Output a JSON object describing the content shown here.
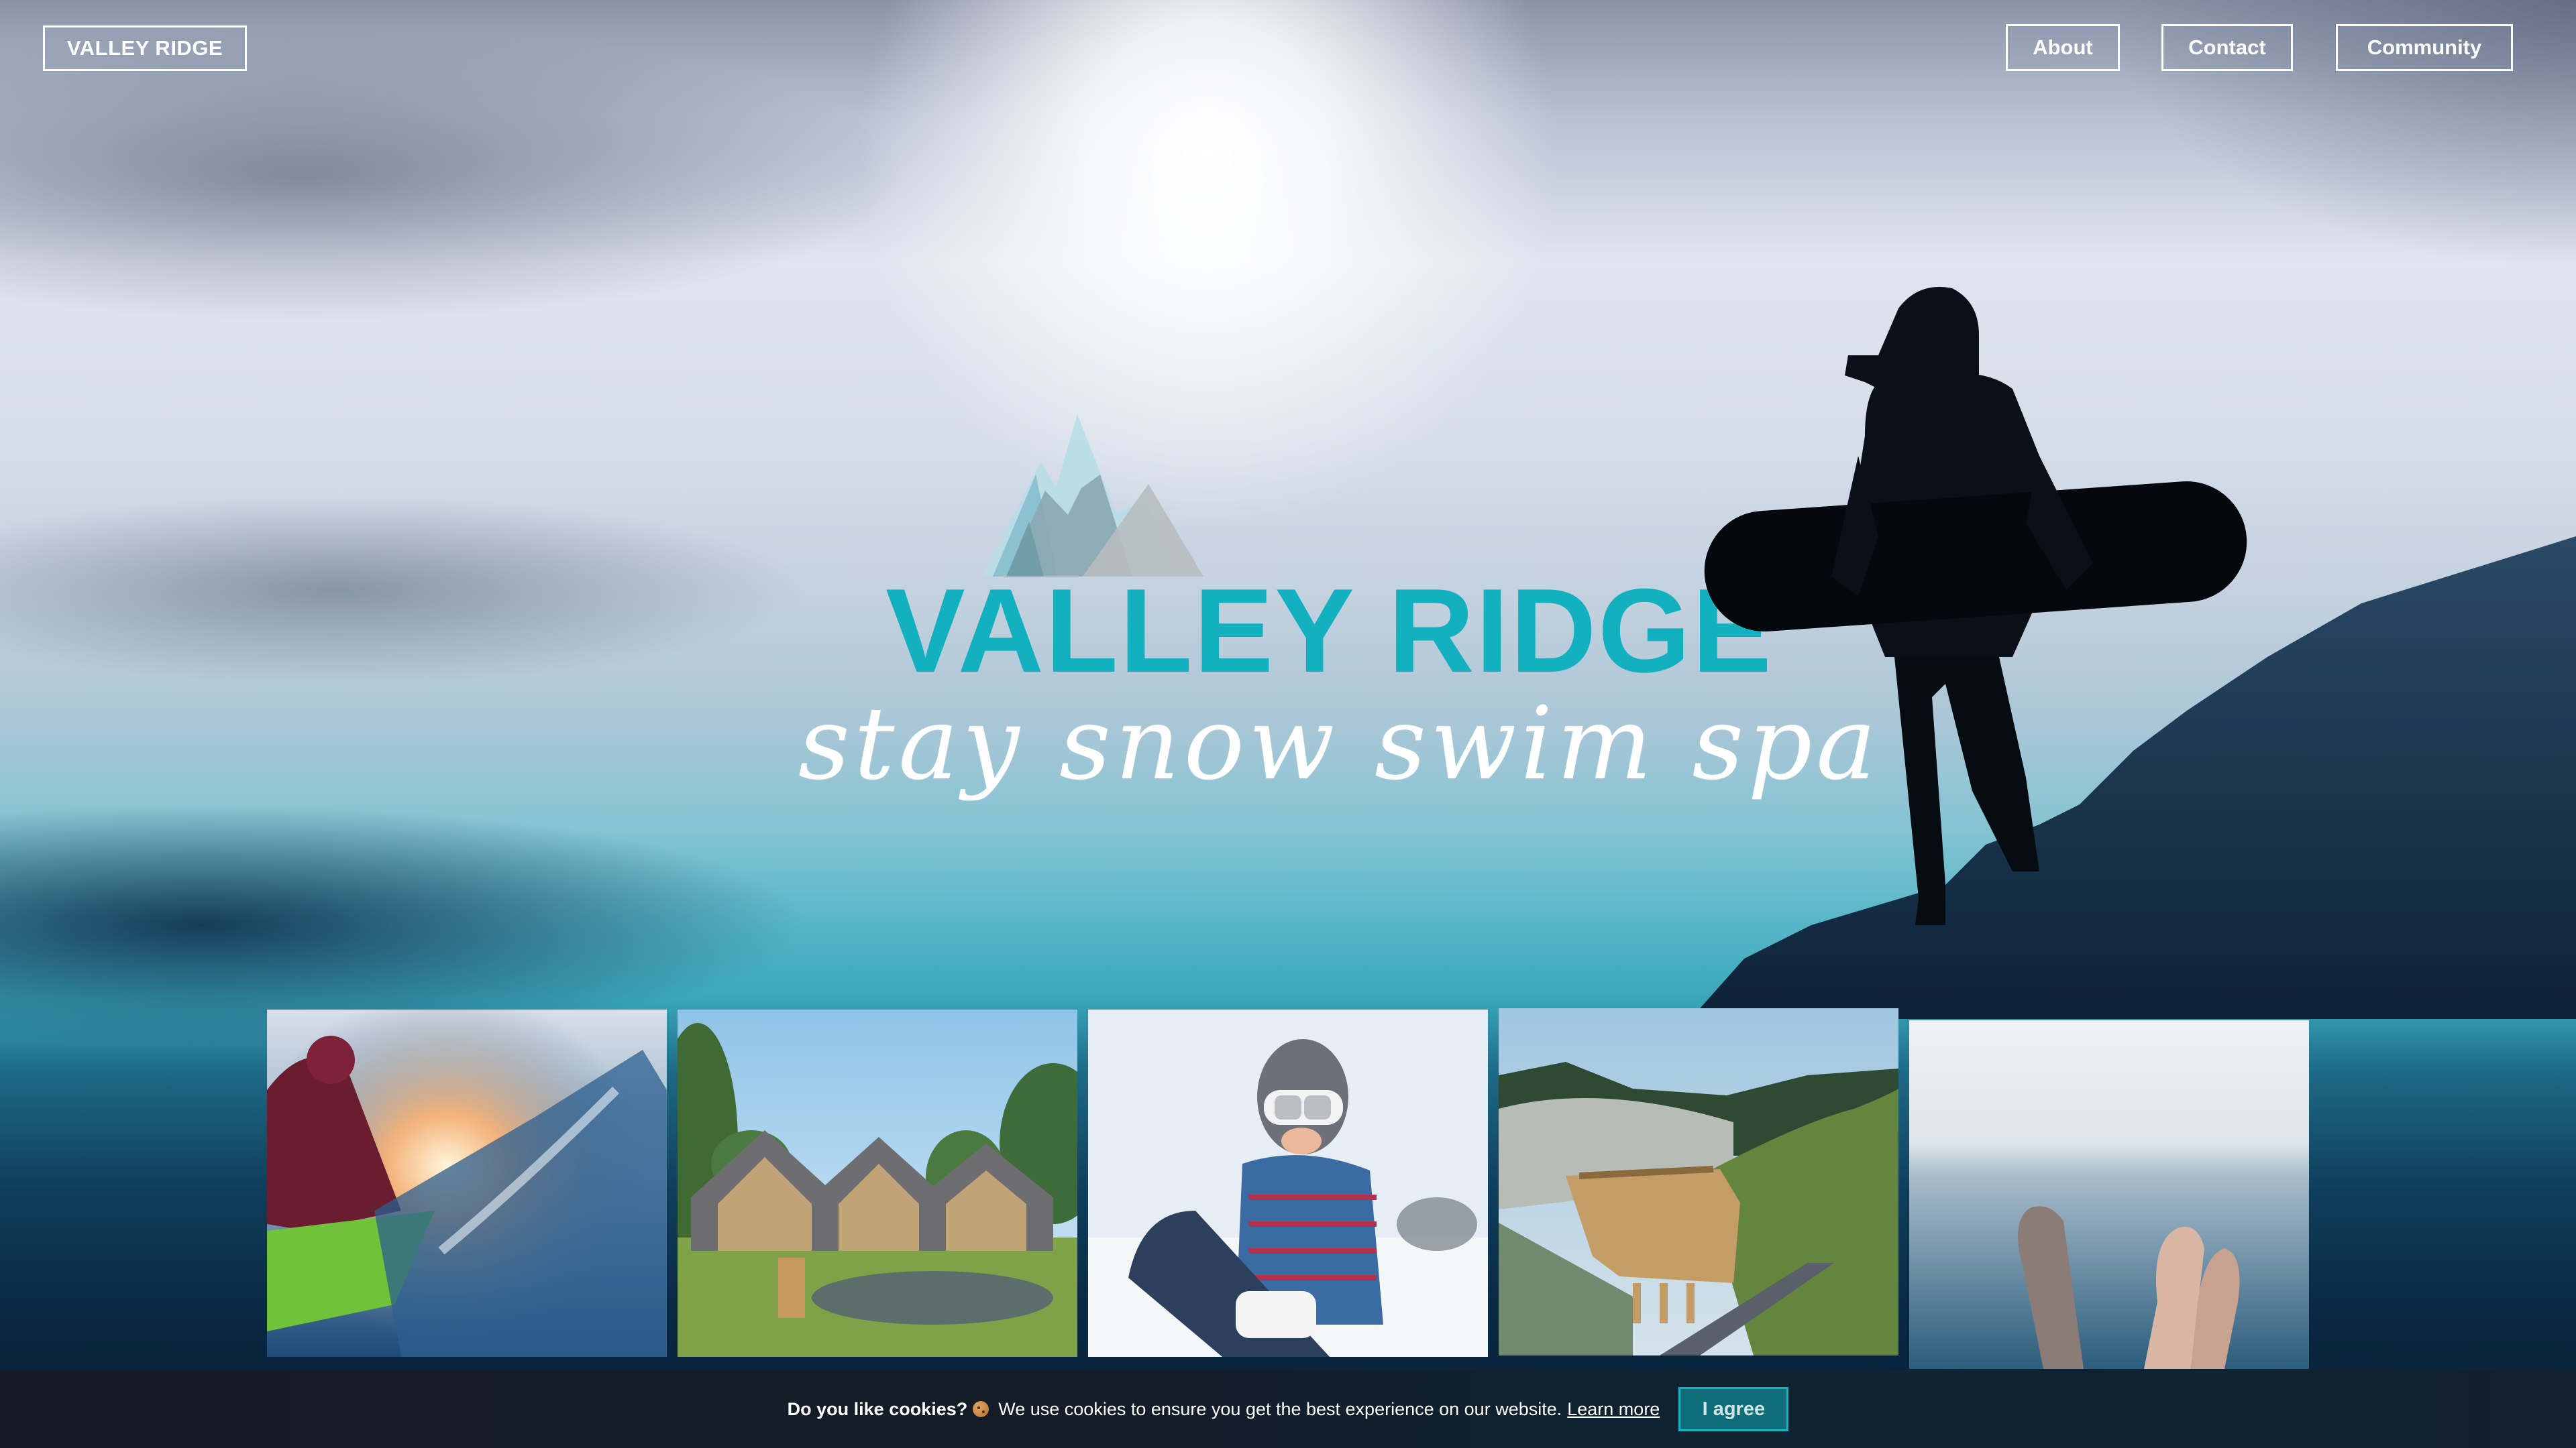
{
  "header": {
    "brand_label": "VALLEY RIDGE",
    "nav": [
      {
        "label": "About"
      },
      {
        "label": "Contact"
      },
      {
        "label": "Community"
      }
    ]
  },
  "hero": {
    "logo_text": "VALLEY RIDGE",
    "tagline": "stay snow swim spa",
    "logo_colors": {
      "text": "#13b0bf",
      "peak_light": "#b7dde5",
      "peak_mid": "#84bccd",
      "peak_dark": "#8aa7b0",
      "peak_grey": "#b7bcbf"
    }
  },
  "gallery": {
    "tiles": [
      {
        "name": "kayaking",
        "alt": "Kayaker paddling through splashing water"
      },
      {
        "name": "lodges",
        "alt": "Timber-framed lodges beside a pond"
      },
      {
        "name": "snowboarding",
        "alt": "Smiling snowboarder with goggles in snow"
      },
      {
        "name": "spa-building",
        "alt": "Spa building with green roof on hillside"
      },
      {
        "name": "hot-pool",
        "alt": "Feet in steaming outdoor hot pool"
      }
    ]
  },
  "cookie": {
    "heading": "Do you like cookies?",
    "icon": "cookie-icon",
    "message": "We use cookies to ensure you get the best experience on our website.",
    "learn_more": "Learn more",
    "agree_label": "I agree",
    "colors": {
      "bar": "#151b26",
      "button_bg": "#0e6d78",
      "button_border": "#17b3c2"
    }
  }
}
